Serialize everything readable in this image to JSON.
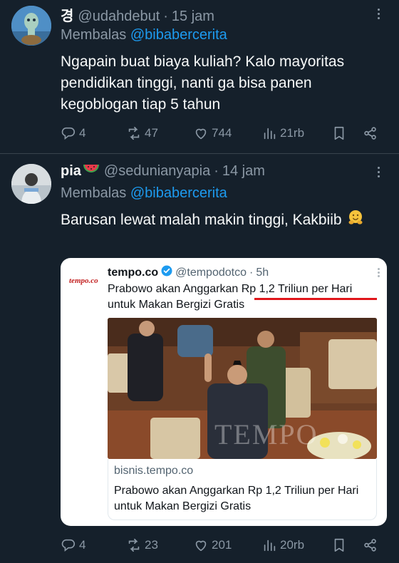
{
  "tweets": [
    {
      "display_name": "경",
      "handle": "@udahdebut",
      "separator": "·",
      "time": "15 jam",
      "reply_prefix": "Membalas",
      "reply_to": "@bibabercerita",
      "text": "Ngapain buat biaya kuliah? Kalo mayoritas pendidikan tinggi, nanti ga bisa panen kegoblogan tiap 5 tahun",
      "replies": "4",
      "retweets": "47",
      "likes": "744",
      "views": "21rb"
    },
    {
      "display_name": "pia",
      "handle": "@sedunianyapia",
      "separator": "·",
      "time": "14 jam",
      "reply_prefix": "Membalas",
      "reply_to": "@bibabercerita",
      "text": "Barusan lewat malah makin tinggi, Kakbiib",
      "replies": "4",
      "retweets": "23",
      "likes": "201",
      "views": "20rb",
      "quote": {
        "logo": "tempo.co",
        "name": "tempo.co",
        "handle": "@tempodotco",
        "separator": "·",
        "time": "5h",
        "text": "Prabowo akan Anggarkan Rp 1,2 Triliun per Hari untuk Makan Bergizi Gratis",
        "watermark": "TEMPO",
        "link_domain": "bisnis.tempo.co",
        "link_title": "Prabowo akan Anggarkan Rp 1,2 Triliun per Hari untuk Makan Bergizi Gratis"
      }
    }
  ],
  "icons": [
    "reply-icon",
    "retweet-icon",
    "like-icon",
    "views-icon",
    "bookmark-icon",
    "share-icon",
    "more-icon",
    "verified-icon",
    "watermelon-emoji",
    "hugging-emoji"
  ],
  "colors": {
    "background": "#15202b",
    "text": "#f7f9f9",
    "muted": "#8b98a5",
    "link": "#1d9bf0",
    "divider": "#38444d",
    "highlight_underline": "#e0161b"
  }
}
